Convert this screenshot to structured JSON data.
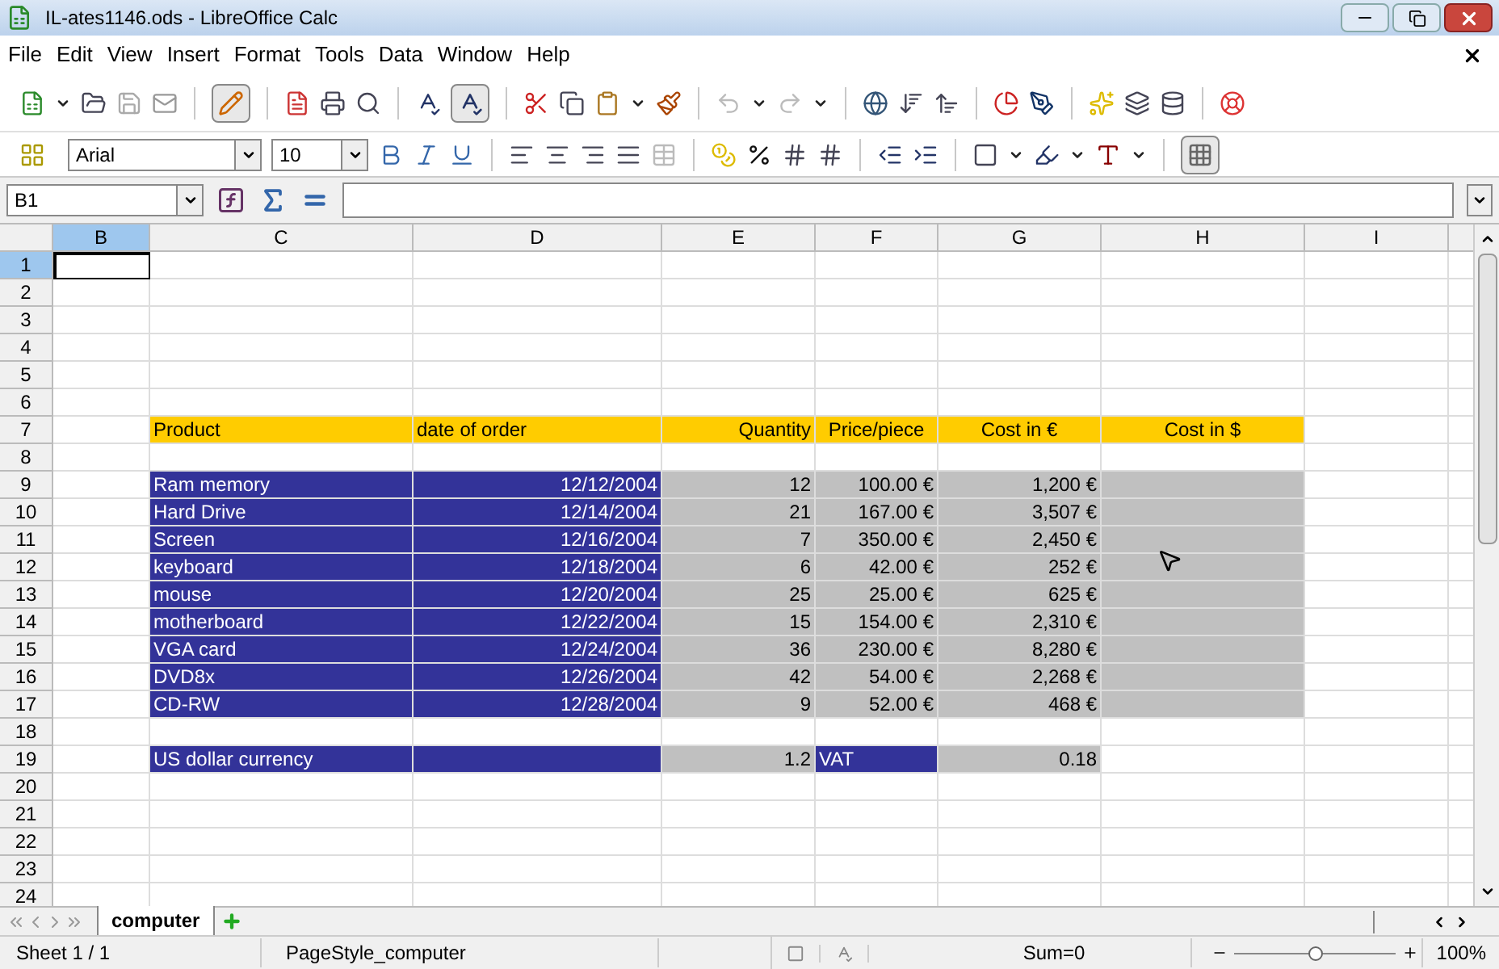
{
  "window": {
    "title": "IL-ates1146.ods - LibreOffice Calc"
  },
  "menu": [
    "File",
    "Edit",
    "View",
    "Insert",
    "Format",
    "Tools",
    "Data",
    "Window",
    "Help"
  ],
  "format_bar": {
    "font_name": "Arial",
    "font_size": "10"
  },
  "formula_bar": {
    "name_box": "B1"
  },
  "columns": [
    {
      "label": "B",
      "selected": true
    },
    {
      "label": "C",
      "selected": false
    },
    {
      "label": "D",
      "selected": false
    },
    {
      "label": "E",
      "selected": false
    },
    {
      "label": "F",
      "selected": false
    },
    {
      "label": "G",
      "selected": false
    },
    {
      "label": "H",
      "selected": false
    },
    {
      "label": "I",
      "selected": false
    }
  ],
  "rows": [
    {
      "number": "1",
      "selected": true
    },
    {
      "number": "2",
      "selected": false
    },
    {
      "number": "3",
      "selected": false
    },
    {
      "number": "4",
      "selected": false
    },
    {
      "number": "5",
      "selected": false
    },
    {
      "number": "6",
      "selected": false
    },
    {
      "number": "7",
      "selected": false,
      "cells": [
        {
          "kind": "empty"
        },
        {
          "kind": "header-left",
          "text": "Product"
        },
        {
          "kind": "header-left",
          "text": "date of order"
        },
        {
          "kind": "header-right",
          "text": "Quantity"
        },
        {
          "kind": "header-center",
          "text": "Price/piece"
        },
        {
          "kind": "header-center",
          "text": "Cost in €"
        },
        {
          "kind": "header-center",
          "text": "Cost in $"
        },
        {
          "kind": "empty"
        }
      ]
    },
    {
      "number": "8",
      "selected": false
    },
    {
      "number": "9",
      "selected": false,
      "cells": [
        {
          "kind": "empty"
        },
        {
          "kind": "label",
          "text": "Ram memory"
        },
        {
          "kind": "label-number",
          "text": "12/12/2004"
        },
        {
          "kind": "value",
          "text": "12"
        },
        {
          "kind": "value",
          "text": "100.00 €"
        },
        {
          "kind": "value",
          "text": "1,200 €"
        },
        {
          "kind": "value"
        },
        {
          "kind": "empty"
        }
      ]
    },
    {
      "number": "10",
      "selected": false,
      "cells": [
        {
          "kind": "empty"
        },
        {
          "kind": "label",
          "text": "Hard Drive"
        },
        {
          "kind": "label-number",
          "text": "12/14/2004"
        },
        {
          "kind": "value",
          "text": "21"
        },
        {
          "kind": "value",
          "text": "167.00 €"
        },
        {
          "kind": "value",
          "text": "3,507 €"
        },
        {
          "kind": "value"
        },
        {
          "kind": "empty"
        }
      ]
    },
    {
      "number": "11",
      "selected": false,
      "cells": [
        {
          "kind": "empty"
        },
        {
          "kind": "label",
          "text": "Screen"
        },
        {
          "kind": "label-number",
          "text": "12/16/2004"
        },
        {
          "kind": "value",
          "text": "7"
        },
        {
          "kind": "value",
          "text": "350.00 €"
        },
        {
          "kind": "value",
          "text": "2,450 €"
        },
        {
          "kind": "value"
        },
        {
          "kind": "empty"
        }
      ]
    },
    {
      "number": "12",
      "selected": false,
      "cells": [
        {
          "kind": "empty"
        },
        {
          "kind": "label",
          "text": "keyboard"
        },
        {
          "kind": "label-number",
          "text": "12/18/2004"
        },
        {
          "kind": "value",
          "text": "6"
        },
        {
          "kind": "value",
          "text": "42.00 €"
        },
        {
          "kind": "value",
          "text": "252 €"
        },
        {
          "kind": "value"
        },
        {
          "kind": "empty"
        }
      ]
    },
    {
      "number": "13",
      "selected": false,
      "cells": [
        {
          "kind": "empty"
        },
        {
          "kind": "label",
          "text": "mouse"
        },
        {
          "kind": "label-number",
          "text": "12/20/2004"
        },
        {
          "kind": "value",
          "text": "25"
        },
        {
          "kind": "value",
          "text": "25.00 €"
        },
        {
          "kind": "value",
          "text": "625 €"
        },
        {
          "kind": "value"
        },
        {
          "kind": "empty"
        }
      ]
    },
    {
      "number": "14",
      "selected": false,
      "cells": [
        {
          "kind": "empty"
        },
        {
          "kind": "label",
          "text": "motherboard"
        },
        {
          "kind": "label-number",
          "text": "12/22/2004"
        },
        {
          "kind": "value",
          "text": "15"
        },
        {
          "kind": "value",
          "text": "154.00 €"
        },
        {
          "kind": "value",
          "text": "2,310 €"
        },
        {
          "kind": "value"
        },
        {
          "kind": "empty"
        }
      ]
    },
    {
      "number": "15",
      "selected": false,
      "cells": [
        {
          "kind": "empty"
        },
        {
          "kind": "label",
          "text": "VGA card"
        },
        {
          "kind": "label-number",
          "text": "12/24/2004"
        },
        {
          "kind": "value",
          "text": "36"
        },
        {
          "kind": "value",
          "text": "230.00 €"
        },
        {
          "kind": "value",
          "text": "8,280 €"
        },
        {
          "kind": "value"
        },
        {
          "kind": "empty"
        }
      ]
    },
    {
      "number": "16",
      "selected": false,
      "cells": [
        {
          "kind": "empty"
        },
        {
          "kind": "label",
          "text": "DVD8x"
        },
        {
          "kind": "label-number",
          "text": "12/26/2004"
        },
        {
          "kind": "value",
          "text": "42"
        },
        {
          "kind": "value",
          "text": "54.00 €"
        },
        {
          "kind": "value",
          "text": "2,268 €"
        },
        {
          "kind": "value"
        },
        {
          "kind": "empty"
        }
      ]
    },
    {
      "number": "17",
      "selected": false,
      "cells": [
        {
          "kind": "empty"
        },
        {
          "kind": "label",
          "text": "CD-RW"
        },
        {
          "kind": "label-number",
          "text": "12/28/2004"
        },
        {
          "kind": "value",
          "text": "9"
        },
        {
          "kind": "value",
          "text": "52.00 €"
        },
        {
          "kind": "value",
          "text": "468 €"
        },
        {
          "kind": "value"
        },
        {
          "kind": "empty"
        }
      ]
    },
    {
      "number": "18",
      "selected": false
    },
    {
      "number": "19",
      "selected": false,
      "cells": [
        {
          "kind": "empty"
        },
        {
          "kind": "label",
          "text": "US dollar currency"
        },
        {
          "kind": "label"
        },
        {
          "kind": "value",
          "text": "1.2"
        },
        {
          "kind": "label",
          "text": "VAT"
        },
        {
          "kind": "value",
          "text": "0.18"
        },
        {
          "kind": "empty"
        },
        {
          "kind": "empty"
        }
      ]
    },
    {
      "number": "20",
      "selected": false
    },
    {
      "number": "21",
      "selected": false
    },
    {
      "number": "22",
      "selected": false
    },
    {
      "number": "23",
      "selected": false
    },
    {
      "number": "24",
      "selected": false
    }
  ],
  "sheet_tabs": [
    {
      "label": "computer",
      "selected": true
    }
  ],
  "status_bar": {
    "sheet": "Sheet 1 / 1",
    "page_style": "PageStyle_computer",
    "sum": "Sum=0",
    "zoom": {
      "level": 0.5
    },
    "zoom_percent": "100%"
  }
}
